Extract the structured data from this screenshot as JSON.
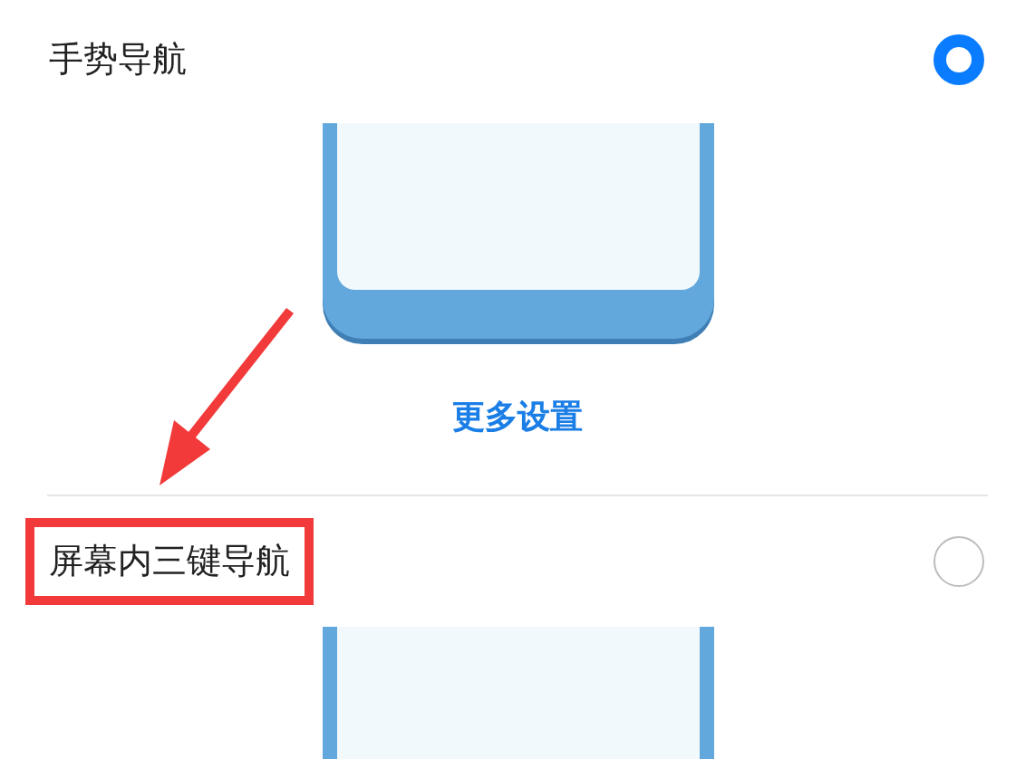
{
  "options": [
    {
      "label": "手势导航",
      "selected": true,
      "highlighted": false,
      "more_link": "更多设置"
    },
    {
      "label": "屏幕内三键导航",
      "selected": false,
      "highlighted": true
    }
  ]
}
